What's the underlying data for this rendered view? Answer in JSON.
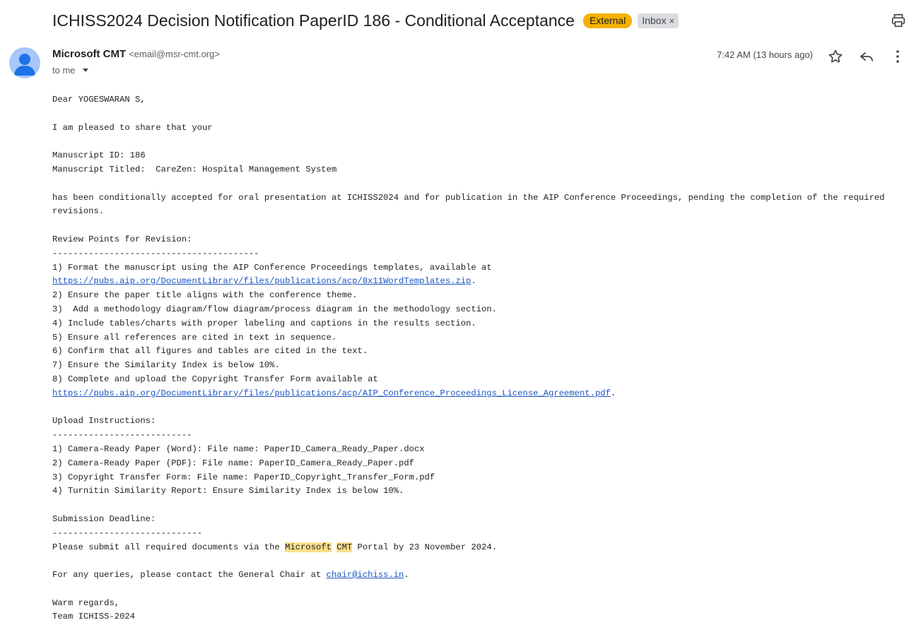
{
  "header": {
    "subject": "ICHISS2024 Decision Notification PaperID 186 - Conditional Acceptance",
    "label_external": "External",
    "label_inbox": "Inbox",
    "label_remove": "×",
    "external_color": "#f6b100",
    "print_icon": "printer-icon"
  },
  "message": {
    "sender_name": "Microsoft CMT",
    "sender_email": "<email@msr-cmt.org>",
    "to": "to me",
    "timestamp": "7:42 AM (13 hours ago)",
    "icons": {
      "star": "star-outline-icon",
      "reply": "reply-icon",
      "more": "more-vert-icon",
      "avatar": "person-avatar-icon"
    }
  },
  "body": {
    "greeting": "Dear YOGESWARAN S,",
    "intro": "I am pleased to share that your",
    "manuscript_id": "Manuscript ID: 186",
    "manuscript_title": "Manuscript Titled:  CareZen: Hospital Management System",
    "acceptance": "has been conditionally accepted for oral presentation at ICHISS2024 and for publication in the AIP Conference Proceedings, pending the completion of the required revisions.",
    "review_heading": "Review Points for Revision:",
    "review_rule": "----------------------------------------",
    "point1_text": "1) Format the manuscript using the AIP Conference Proceedings templates, available at ",
    "point1_link": "https://pubs.aip.org/DocumentLibrary/files/publications/acp/8x11WordTemplates.zip",
    "point1_end": ".",
    "point2": "2) Ensure the paper title aligns with the conference theme.",
    "point3": "3)  Add a methodology diagram/flow diagram/process diagram in the methodology section.",
    "point4": "4) Include tables/charts with proper labeling and captions in the results section.",
    "point5": "5) Ensure all references are cited in text in sequence.",
    "point6": "6) Confirm that all figures and tables are cited in the text.",
    "point7": "7) Ensure the Similarity Index is below 10%.",
    "point8_text": "8) Complete and upload the Copyright Transfer Form available at ",
    "point8_link": "https://pubs.aip.org/DocumentLibrary/files/publications/acp/AIP_Conference_Proceedings_License_Agreement.pdf",
    "point8_end": ".",
    "upload_heading": "Upload Instructions:",
    "upload_rule": "---------------------------",
    "upload1": "1) Camera-Ready Paper (Word): File name: PaperID_Camera_Ready_Paper.docx",
    "upload2": "2) Camera-Ready Paper (PDF): File name: PaperID_Camera_Ready_Paper.pdf",
    "upload3": "3) Copyright Transfer Form: File name: PaperID_Copyright_Transfer_Form.pdf",
    "upload4": "4) Turnitin Similarity Report: Ensure Similarity Index is below 10%.",
    "deadline_heading": "Submission Deadline:",
    "deadline_rule": "-----------------------------",
    "deadline_pre": "Please submit all required documents via the ",
    "deadline_hl1": "Microsoft",
    "deadline_space": " ",
    "deadline_hl2": "CMT",
    "deadline_post": " Portal by 23 November 2024.",
    "contact_pre": "For any queries, please contact the General Chair at ",
    "contact_link": "chair@ichiss.in",
    "contact_end": ".",
    "signoff": "Warm regards,",
    "team": "Team ICHISS-2024"
  }
}
